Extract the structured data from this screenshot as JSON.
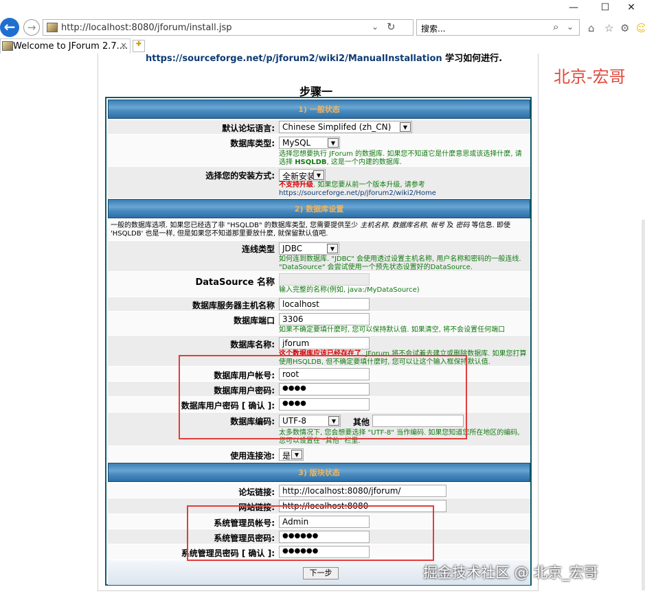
{
  "browser": {
    "url": "http://localhost:8080/jforum/install.jsp",
    "search_placeholder": "搜索...",
    "tab_title": "Welcome to JForum 2.7....",
    "tab_close": "×",
    "minimize_glyph": "—",
    "maximize_glyph": "☐",
    "close_glyph": "✕",
    "refresh_glyph": "↻",
    "search_glyph": "⌕"
  },
  "page": {
    "doc_link": "https://sourceforge.net/p/jforum2/wiki2/ManualInstallation",
    "doc_link_tail": " 学习如何进行.",
    "step_title": "步骤一"
  },
  "sections": {
    "general": "1) 一般状态",
    "database": "2) 数据库设置",
    "modules": "3) 版块状态"
  },
  "general": {
    "language_label": "默认论坛语言:",
    "language_value": "Chinese Simplifed (zh_CN)",
    "dbtype_label": "数据库类型:",
    "dbtype_value": "MySQL",
    "dbtype_hint_1": "选择您想要执行 JForum 的数据库. 如果您不知道它是什麼意思或该选择什麼, 请",
    "dbtype_hint_2a": "选择 ",
    "dbtype_hint_2b": "HSQLDB",
    "dbtype_hint_2c": ", 这是一个内建的数据库.",
    "install_label": "选择您的安装方式:",
    "install_value": "全新安装",
    "install_hint_red": "不支持升级",
    "install_hint_rest": ". 如果您要从前一个版本升级, 请参考",
    "install_hint_link": "https://sourceforge.net/p/jforum2/wiki2/Home"
  },
  "database": {
    "intro_1a": "一般的数据库选项. 如果您已经选了非 \"HSQLDB\" 的数据库类型, 您需要提供至少 ",
    "intro_1b": "主机名称, 数据库名称, 帐号",
    "intro_1c": " 及 ",
    "intro_1d": "密码",
    "intro_1e": " 等信息. 即使",
    "intro_2": "'HSQLDB' 也是一样, 但是如果您不知道那里要放什麼, 就保留默认值吧.",
    "conn_label": "连线类型",
    "conn_value": "JDBC",
    "conn_hint_1": "如何连到数据库. \"JDBC\" 会使用透过设置主机名称, 用户名称和密码的一般连线.",
    "conn_hint_2": "\"DataSource\" 会尝试使用一个预先状态设置好的DataSource.",
    "ds_label": "DataSource 名称",
    "ds_hint": "输入完整的名称(例如, java:/MyDataSource)",
    "host_label": "数据库服务器主机名称",
    "host_value": "localhost",
    "port_label": "数据库端口",
    "port_value": "3306",
    "port_hint": "如果不确定要填什麼时, 您可以保持默认值. 如果清空, 将不会设置任何端口",
    "dbname_label": "数据库名称:",
    "dbname_value": "jforum",
    "dbname_hint_red": "这个数据库应该已经存在了",
    "dbname_hint_1": ". JForum 将不会试着去建立或删除数据库. 如果您打算",
    "dbname_hint_2": "使用HSQLDB, 但不确定要填什麼时, 您可以让这个输入框保持默认值.",
    "user_label": "数据库用户帐号:",
    "user_value": "root",
    "pass_label": "数据库用户密码:",
    "pass_value": "●●●●",
    "pass2_label": "数据库用户密码 [ 确认 ]:",
    "pass2_value": "●●●●",
    "enc_label": "数据库编码:",
    "enc_value": "UTF-8",
    "enc_other_label": "其他",
    "enc_hint_1": "太多数情况下, 您会想要选择 \"UTF-8\" 当作编码. 如果您知道您所在地区的编码,",
    "enc_hint_2": "您可以设置在 \"其他\" 栏里.",
    "pool_label": "使用连接池:",
    "pool_value": "是"
  },
  "modules": {
    "forum_link_label": "论坛链接:",
    "forum_link_value": "http://localhost:8080/jforum/",
    "site_link_label": "网站链接:",
    "site_link_value": "http://localhost:8080",
    "admin_user_label": "系统管理员帐号:",
    "admin_user_value": "Admin",
    "admin_pass_label": "系统管理员密码:",
    "admin_pass_value": "●●●●●●",
    "admin_pass2_label": "系统管理员密码 [ 确认 ]:",
    "admin_pass2_value": "●●●●●●",
    "next_button": "下一步"
  },
  "watermarks": {
    "corner": "北京-宏哥",
    "bottom": "掘金技术社区 @ 北京_宏哥"
  }
}
